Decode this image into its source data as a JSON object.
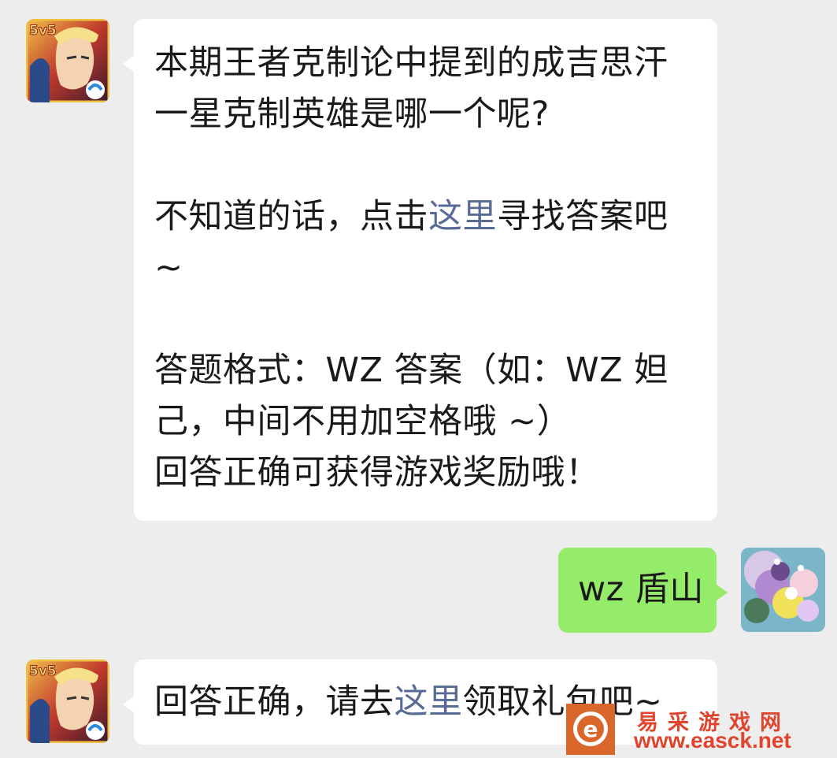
{
  "chat": {
    "message1": {
      "line1": "本期王者克制论中提到的成吉思汗",
      "line2": "一星克制英雄是哪一个呢?",
      "line3_pre": "不知道的话，点击",
      "line3_link": "这里",
      "line3_post": "寻找答案吧",
      "line4": "~",
      "line5": "答题格式：WZ 答案（如：WZ 妲",
      "line6": "己，中间不用加空格哦 ~）",
      "line7": "回答正确可获得游戏奖励哦！"
    },
    "message2": {
      "text": "wz 盾山"
    },
    "message3": {
      "pre": "回答正确，请去",
      "link": "这里",
      "post": "领取礼包吧~"
    }
  },
  "avatars": {
    "bot_badge": "5v5"
  },
  "watermark": {
    "title": "易采游戏网",
    "url": "www.easck.net",
    "logo_letter": "e"
  },
  "colors": {
    "background": "#ededed",
    "bubble_left": "#ffffff",
    "bubble_right": "#95ec69",
    "link": "#576b95",
    "watermark": "#e0442d"
  }
}
